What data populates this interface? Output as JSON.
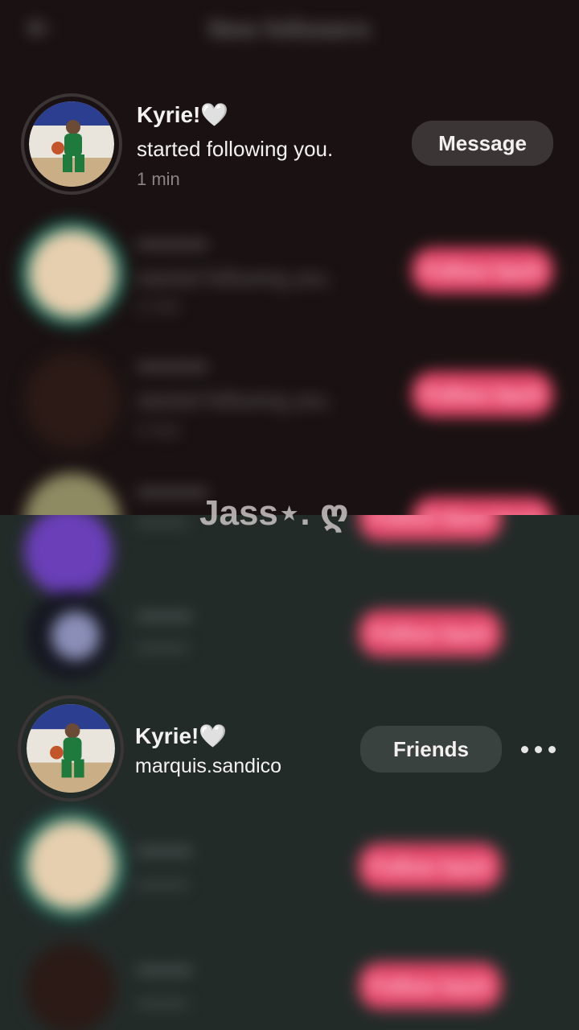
{
  "header": {
    "title": "New followers"
  },
  "top_notification": {
    "name": "Kyrie!🤍",
    "action": "started following you.",
    "time": "1 min",
    "button_label": "Message"
  },
  "blurred_top_rows": [
    {
      "name": "•••••••••",
      "action": "started following you.",
      "time": "2 min",
      "button_label": "Follow back"
    },
    {
      "name": "•••••••••",
      "action": "started following you.",
      "time": "3 min",
      "button_label": "Follow back"
    },
    {
      "name": "•••••••••",
      "action": "started following you.",
      "time": "",
      "button_label": "Follow back"
    }
  ],
  "watermark": "Jass⋆. ღ",
  "friend_row": {
    "name": "Kyrie!🤍",
    "username": "marquis.sandico",
    "button_label": "Friends"
  },
  "blurred_bottom_rows": [
    {
      "name": "•••••••",
      "username": "•••••••",
      "button_label": "Follow back"
    },
    {
      "name": "•••••••",
      "username": "•••••••",
      "button_label": "Follow back"
    },
    {
      "name": "•••••••",
      "username": "•••••••",
      "button_label": "Follow back"
    },
    {
      "name": "•••••••",
      "username": "•••••••",
      "button_label": "Follow back"
    }
  ],
  "colors": {
    "accent_pink": "#e8486b",
    "dark_button": "#3b3535",
    "top_bg": "#1a1212",
    "bottom_bg": "#232b29"
  },
  "icons": {
    "back": "back-arrow-icon",
    "more": "more-dots-icon"
  }
}
